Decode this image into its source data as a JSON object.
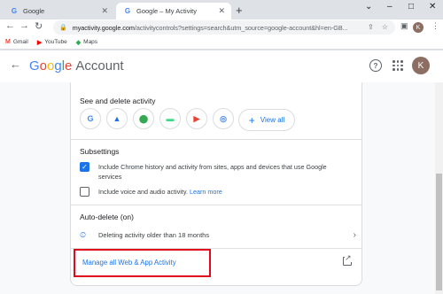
{
  "browser": {
    "tabs": [
      {
        "title": "Google",
        "icon": "google-g-icon"
      },
      {
        "title": "Google – My Activity",
        "icon": "google-g-icon"
      }
    ],
    "new_tab": "+",
    "window_controls": [
      "⌄",
      "–",
      "□",
      "✕"
    ],
    "url": {
      "prefix": "myactivity.google.com",
      "rest": "/activitycontrols?settings=search&utm_source=google-account&hl=en-GB..."
    },
    "profile_initial": "K",
    "bookmarks": [
      {
        "label": "Gmail",
        "icon": "gmail-icon"
      },
      {
        "label": "YouTube",
        "icon": "youtube-icon"
      },
      {
        "label": "Maps",
        "icon": "maps-icon"
      }
    ]
  },
  "header": {
    "logo_letters": [
      "G",
      "o",
      "o",
      "g",
      "l",
      "e"
    ],
    "logo_suffix": "Account",
    "help": "?",
    "avatar_initial": "K"
  },
  "see_delete": {
    "title": "See and delete activity",
    "apps": [
      {
        "name": "google-search-icon",
        "glyph": "G",
        "color": "#4285f4"
      },
      {
        "name": "google-ads-icon",
        "glyph": "▲",
        "color": "#1a73e8"
      },
      {
        "name": "google-maps-icon",
        "glyph": "⬤",
        "color": "#34a853"
      },
      {
        "name": "android-icon",
        "glyph": "▬",
        "color": "#3ddc84"
      },
      {
        "name": "google-play-icon",
        "glyph": "▶",
        "color": "#ea4335"
      },
      {
        "name": "google-lens-icon",
        "glyph": "◎",
        "color": "#4285f4"
      }
    ],
    "view_all": "View all"
  },
  "subsettings": {
    "title": "Subsettings",
    "chrome_history": "Include Chrome history and activity from sites, apps and devices that use Google",
    "chrome_history_cont": "services",
    "voice_audio": "Include voice and audio activity.",
    "learn_more": "Learn more"
  },
  "autodelete": {
    "title": "Auto-delete (on)",
    "status": "Deleting activity older than 18 months"
  },
  "manage": {
    "link": "Manage all Web & App Activity"
  },
  "colors": {
    "accent": "#1a73e8",
    "highlight": "#e10a1c"
  }
}
